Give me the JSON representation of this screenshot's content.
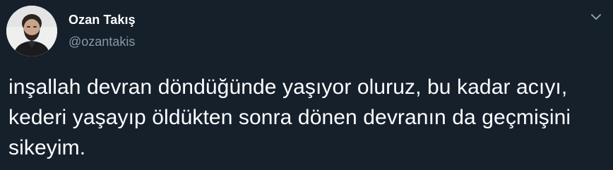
{
  "tweet": {
    "author": {
      "display_name": "Ozan Takış",
      "handle": "@ozantakis",
      "avatar_icon": "profile-photo"
    },
    "menu_icon": "chevron-down-icon",
    "text": "inşallah devran döndüğünde yaşıyor oluruz, bu kadar acıyı, kederi yaşayıp öldükten sonra dönen devranın da geçmişini sikeyim."
  },
  "colors": {
    "background": "#15202b",
    "text": "#ffffff",
    "secondary_text": "#8899a6"
  }
}
